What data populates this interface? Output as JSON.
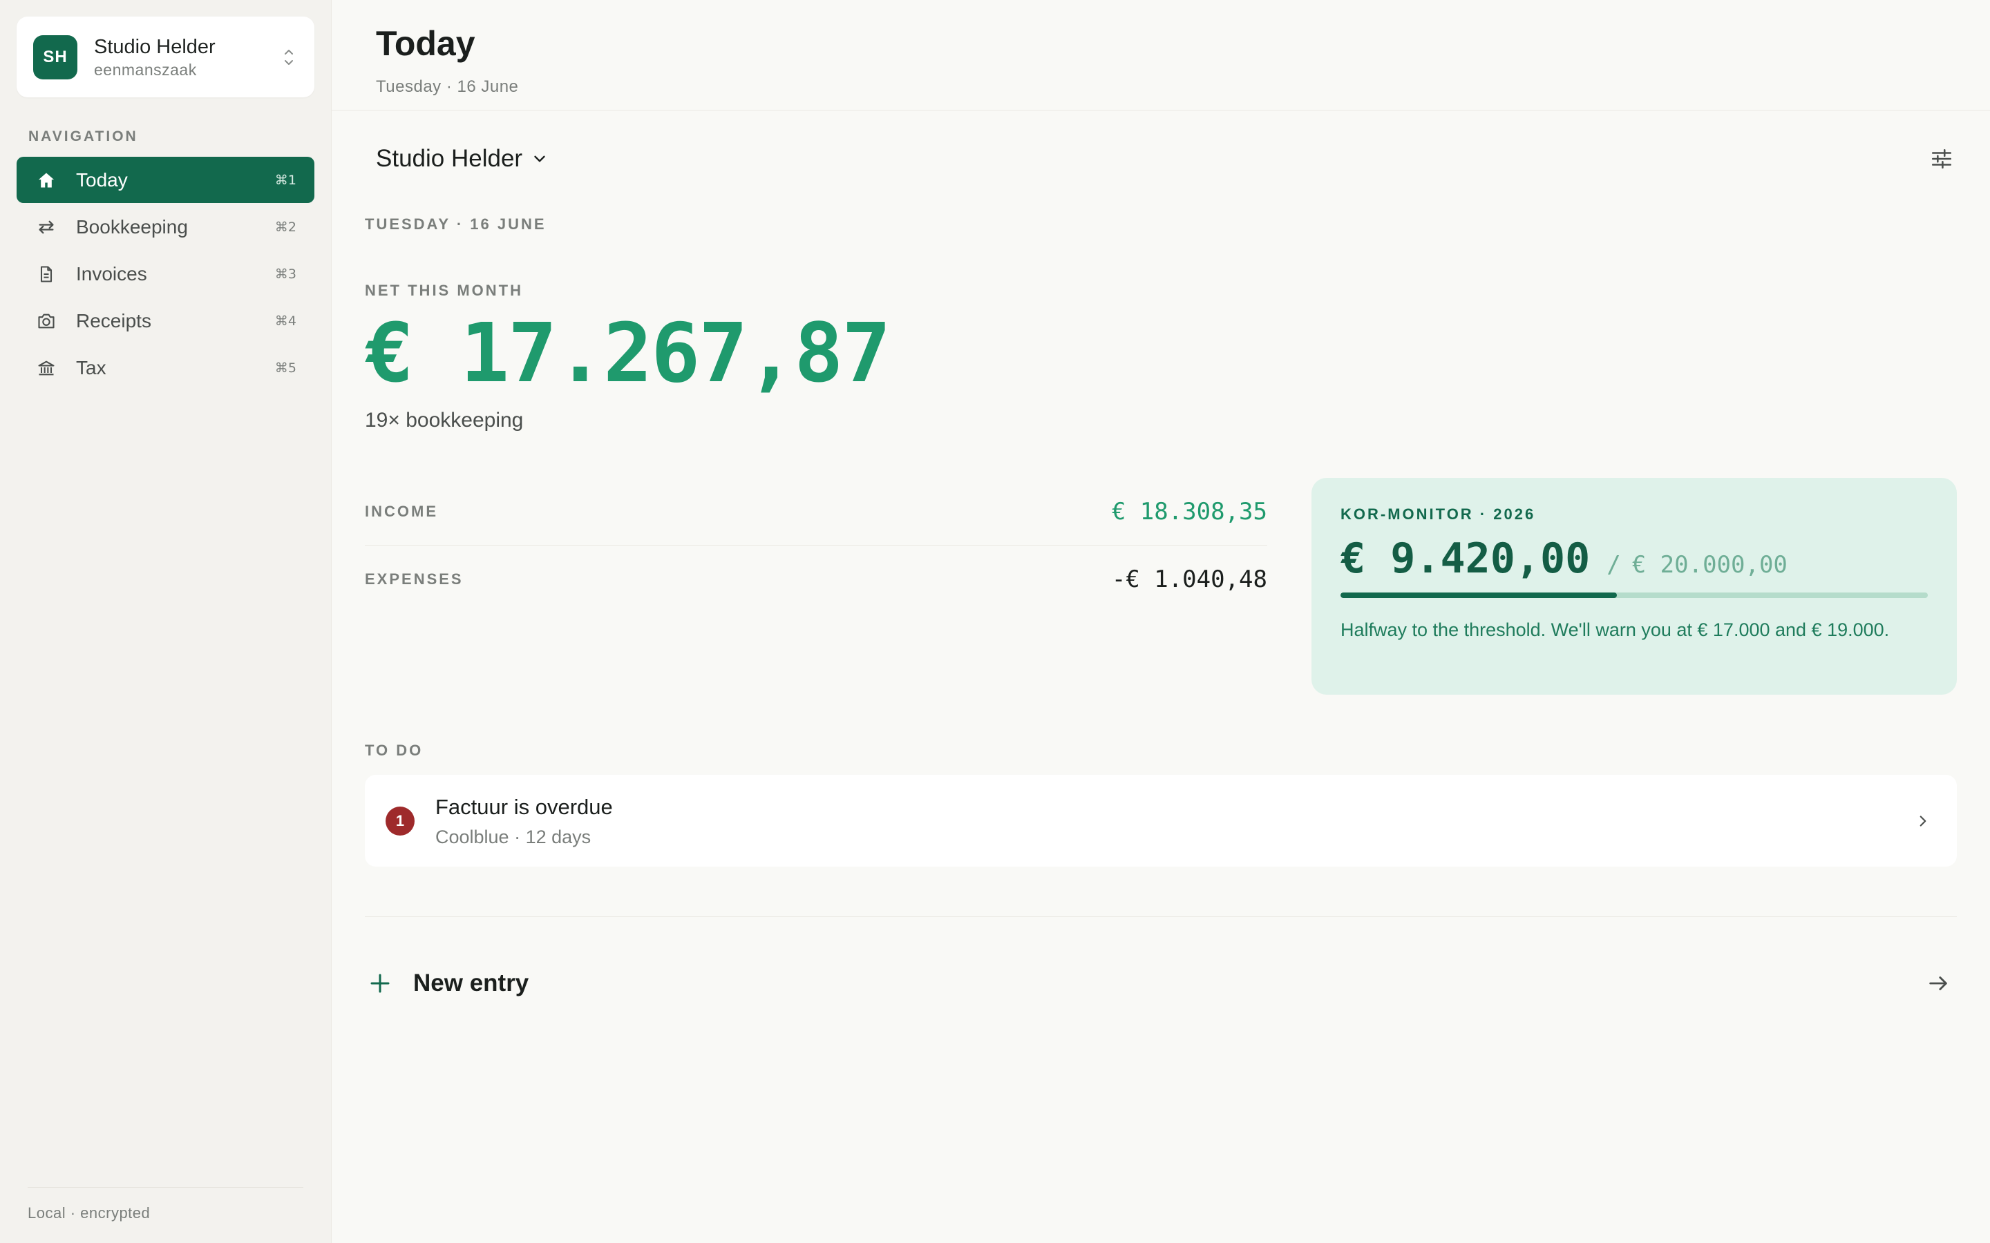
{
  "org": {
    "initials": "SH",
    "name": "Studio Helder",
    "type": "eenmanszaak"
  },
  "sidebar": {
    "heading": "NAVIGATION",
    "items": [
      {
        "label": "Today",
        "shortcut": "⌘1",
        "icon": "home-icon",
        "active": true
      },
      {
        "label": "Bookkeeping",
        "shortcut": "⌘2",
        "icon": "arrows-exchange-icon",
        "active": false
      },
      {
        "label": "Invoices",
        "shortcut": "⌘3",
        "icon": "document-icon",
        "active": false
      },
      {
        "label": "Receipts",
        "shortcut": "⌘4",
        "icon": "camera-icon",
        "active": false
      },
      {
        "label": "Tax",
        "shortcut": "⌘5",
        "icon": "bank-icon",
        "active": false
      }
    ],
    "footer": "Local · encrypted"
  },
  "header": {
    "title": "Today",
    "subtitle": "Tuesday · 16 June"
  },
  "toolbar": {
    "workspace": "Studio Helder",
    "filter_icon": "sliders-icon"
  },
  "summary": {
    "date_caption": "TUESDAY · 16 JUNE",
    "net_label": "NET THIS MONTH",
    "net_value": "€ 17.267,87",
    "net_sub": "19× bookkeeping",
    "income_label": "INCOME",
    "income_value": "€ 18.308,35",
    "expenses_label": "EXPENSES",
    "expenses_value": "-€ 1.040,48"
  },
  "kor": {
    "label": "KOR-MONITOR · 2026",
    "current": "€ 9.420,00",
    "separator": "/",
    "limit": "€ 20.000,00",
    "progress": 0.471,
    "note": "Halfway to the threshold. We'll warn you at € 17.000 and € 19.000."
  },
  "todo": {
    "heading": "TO DO",
    "items": [
      {
        "badge": "1",
        "title": "Factuur is overdue",
        "subtitle": "Coolblue · 12 days"
      }
    ]
  },
  "new_entry": {
    "label": "New entry"
  },
  "colors": {
    "accent": "#12694d",
    "accent_bright": "#1f9a6d",
    "kor_bg": "#dff2ea",
    "danger": "#9e2a2b"
  }
}
